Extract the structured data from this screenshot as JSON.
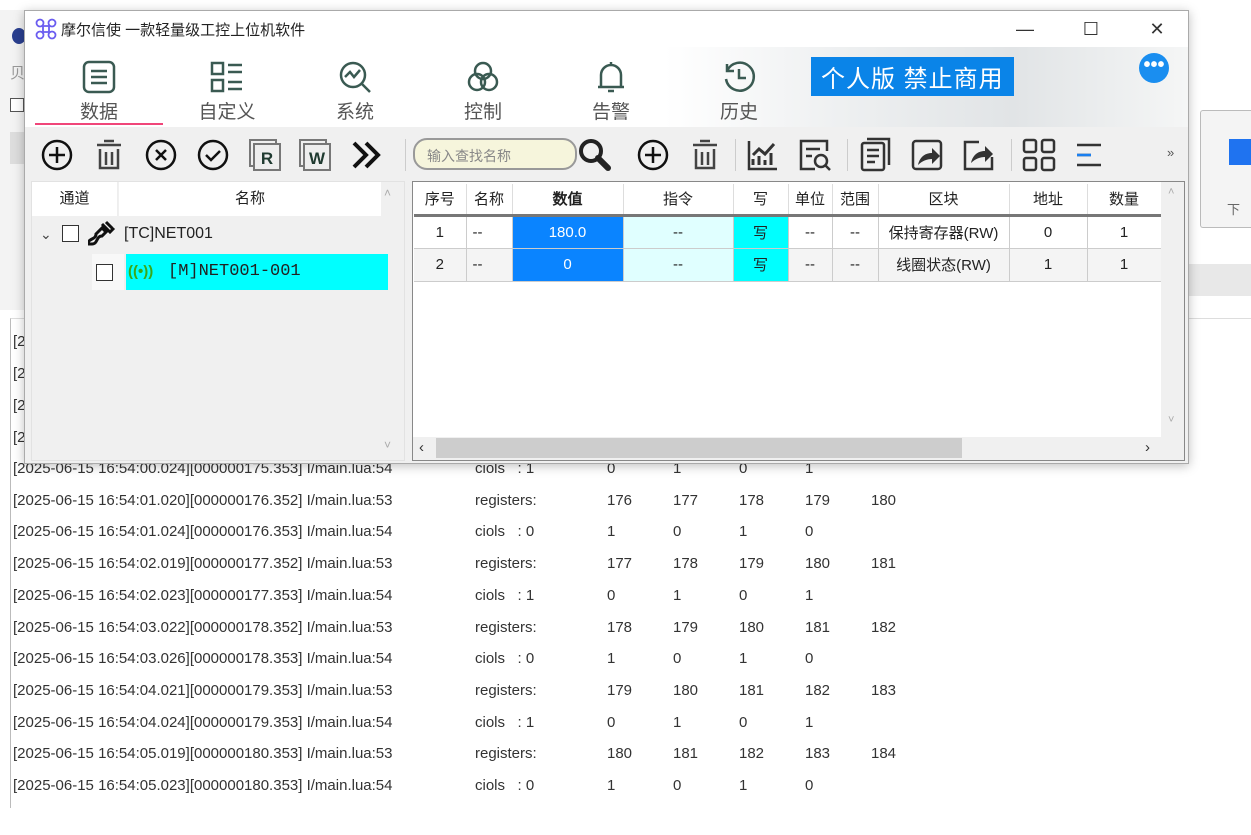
{
  "app": {
    "title": "摩尔信使   一款轻量级工控上位机软件",
    "banner": "个人版  禁止商用",
    "more": "•••",
    "minimize": "—",
    "maximize": "☐",
    "close": "✕"
  },
  "background": {
    "left_label": "贝",
    "right_button_label": "下"
  },
  "nav": [
    {
      "label": "数据",
      "icon": "list-icon"
    },
    {
      "label": "自定义",
      "icon": "layout-icon"
    },
    {
      "label": "系统",
      "icon": "chart-search-icon"
    },
    {
      "label": "控制",
      "icon": "control-icon"
    },
    {
      "label": "告警",
      "icon": "bell-icon"
    },
    {
      "label": "历史",
      "icon": "history-icon"
    }
  ],
  "search": {
    "placeholder": "输入查找名称"
  },
  "tree": {
    "headers": [
      "通道",
      "名称"
    ],
    "channel": "[TC]NET001",
    "device": "[M]NET001-001"
  },
  "table": {
    "headers": [
      "序号",
      "名称",
      "数值",
      "指令",
      "写",
      "单位",
      "范围",
      "区块",
      "地址",
      "数量"
    ],
    "rows": [
      [
        "1",
        "--",
        "180.0",
        "--",
        "写",
        "--",
        "--",
        "保持寄存器(RW)",
        "0",
        "1"
      ],
      [
        "2",
        "--",
        "0",
        "--",
        "写",
        "--",
        "--",
        "线圈状态(RW)",
        "1",
        "1"
      ]
    ]
  },
  "log": {
    "partial": [
      "[2",
      "[2",
      "[2",
      "[2"
    ],
    "lines": [
      [
        "[2025-06-15 16:54:00.024][000000175.353] I/main.lua:54",
        "ciols   : 1",
        "0",
        "1",
        "0",
        "1",
        ""
      ],
      [
        "[2025-06-15 16:54:01.020][000000176.352] I/main.lua:53",
        "registers:",
        "176",
        "177",
        "178",
        "179",
        "180"
      ],
      [
        "[2025-06-15 16:54:01.024][000000176.353] I/main.lua:54",
        "ciols   : 0",
        "1",
        "0",
        "1",
        "0",
        ""
      ],
      [
        "[2025-06-15 16:54:02.019][000000177.352] I/main.lua:53",
        "registers:",
        "177",
        "178",
        "179",
        "180",
        "181"
      ],
      [
        "[2025-06-15 16:54:02.023][000000177.353] I/main.lua:54",
        "ciols   : 1",
        "0",
        "1",
        "0",
        "1",
        ""
      ],
      [
        "[2025-06-15 16:54:03.022][000000178.352] I/main.lua:53",
        "registers:",
        "178",
        "179",
        "180",
        "181",
        "182"
      ],
      [
        "[2025-06-15 16:54:03.026][000000178.353] I/main.lua:54",
        "ciols   : 0",
        "1",
        "0",
        "1",
        "0",
        ""
      ],
      [
        "[2025-06-15 16:54:04.021][000000179.353] I/main.lua:53",
        "registers:",
        "179",
        "180",
        "181",
        "182",
        "183"
      ],
      [
        "[2025-06-15 16:54:04.024][000000179.353] I/main.lua:54",
        "ciols   : 1",
        "0",
        "1",
        "0",
        "1",
        ""
      ],
      [
        "[2025-06-15 16:54:05.019][000000180.353] I/main.lua:53",
        "registers:",
        "180",
        "181",
        "182",
        "183",
        "184"
      ],
      [
        "[2025-06-15 16:54:05.023][000000180.353] I/main.lua:54",
        "ciols   : 0",
        "1",
        "0",
        "1",
        "0",
        ""
      ]
    ]
  },
  "colors": {
    "accent": "#0a84e8",
    "cyan": "#00ffff",
    "light_cyan": "#e0ffff",
    "value_blue": "#0a84ff",
    "nav_underline": "#f0467a"
  }
}
